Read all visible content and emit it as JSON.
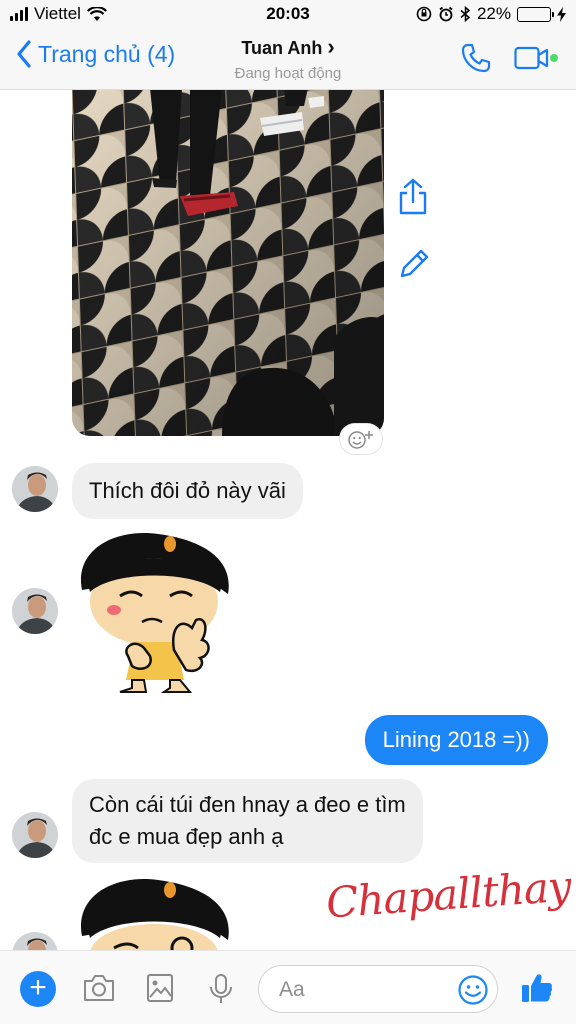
{
  "status_bar": {
    "carrier": "Viettel",
    "time": "20:03",
    "battery": "22%",
    "battery_level": 0.22
  },
  "header": {
    "back_label": "Trang chủ (4)",
    "contact_name": "Tuan Anh",
    "contact_chevron": "›",
    "contact_status": "Đang hoạt động",
    "call_icon": "phone-icon",
    "video_icon": "video-camera-icon",
    "accent_color": "#1a7cf3",
    "online_color": "#4cd964"
  },
  "messages": [
    {
      "type": "image",
      "sender": "them",
      "description_icon": "photo"
    },
    {
      "type": "text",
      "sender": "them",
      "text": "Thích đôi đỏ này vãi"
    },
    {
      "type": "sticker",
      "sender": "them"
    },
    {
      "type": "text",
      "sender": "me",
      "text": "Lining 2018 =))"
    },
    {
      "type": "text",
      "sender": "them",
      "lines": [
        "Còn cái túi đen hnay a đeo e tìm",
        "đc e mua đẹp anh ạ"
      ]
    },
    {
      "type": "sticker",
      "sender": "them"
    }
  ],
  "side_actions": [
    "share-icon",
    "edit-icon"
  ],
  "watermark": "Chapallthay",
  "composer": {
    "placeholder": "Aa",
    "plus_label": "+",
    "tools": [
      "camera-icon",
      "gallery-icon",
      "microphone-icon"
    ],
    "emoji_icon": "smiley-icon",
    "like_icon": "thumbs-up-icon",
    "accent_color": "#1d86f7"
  }
}
